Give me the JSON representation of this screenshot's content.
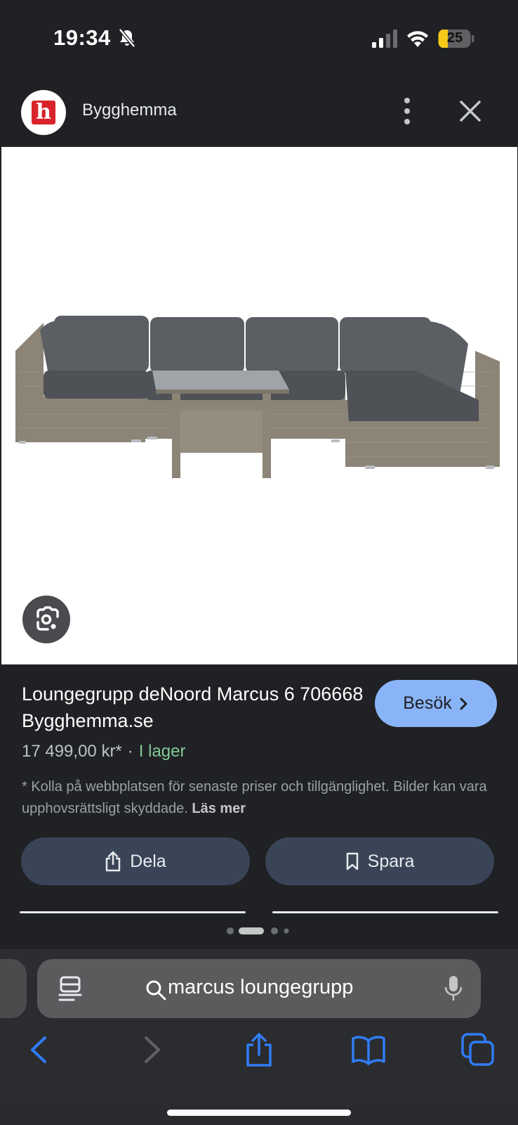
{
  "status_bar": {
    "time": "19:34",
    "battery": "25"
  },
  "header": {
    "site_name": "Bygghemma",
    "logo_letter": "h"
  },
  "product": {
    "title": "Loungegrupp deNoord Marcus 6 706668 Bygghemma.se",
    "visit_label": "Besök",
    "price": "17 499,00 kr*",
    "separator": "·",
    "stock": "I lager",
    "disclaimer": "* Kolla på webbplatsen för senaste priser och tillgänglighet. Bilder kan vara upphovsrättsligt skyddade.",
    "read_more": "Läs mer"
  },
  "actions": {
    "share_label": "Dela",
    "save_label": "Spara"
  },
  "browser": {
    "query": "marcus loungegrupp"
  },
  "colors": {
    "accent": "#8ab4f8",
    "stock_green": "#81c995",
    "brand_red": "#d8232a"
  }
}
